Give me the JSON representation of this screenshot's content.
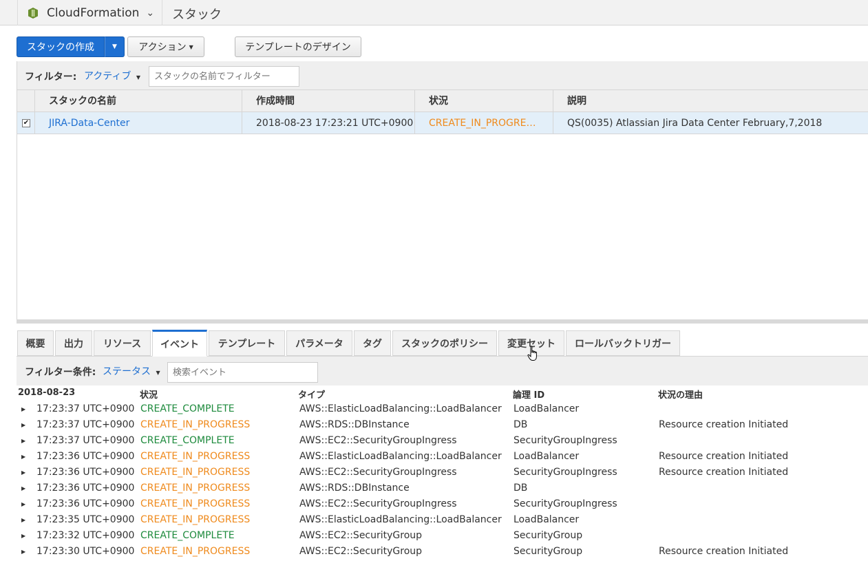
{
  "header": {
    "service_name": "CloudFormation",
    "breadcrumb": "スタック",
    "service_icon": "cloudformation-icon",
    "accent": "#1e6fd1"
  },
  "toolbar": {
    "create_label": "スタックの作成",
    "action_label": "アクション",
    "design_label": "テンプレートのデザイン"
  },
  "stack_filter": {
    "label": "フィルター:",
    "value": "アクティブ",
    "placeholder": "スタックの名前でフィルター"
  },
  "stack_table": {
    "columns": [
      "スタックの名前",
      "作成時間",
      "状況",
      "説明"
    ],
    "rows": [
      {
        "name": "JIRA-Data-Center",
        "created": "2018-08-23 17:23:21 UTC+0900",
        "status": "CREATE_IN_PROGRE…",
        "description": "QS(0035) Atlassian Jira Data Center February,7,2018"
      }
    ]
  },
  "tabs": [
    "概要",
    "出力",
    "リソース",
    "イベント",
    "テンプレート",
    "パラメータ",
    "タグ",
    "スタックのポリシー",
    "変更セット",
    "ロールバックトリガー"
  ],
  "active_tab": "イベント",
  "event_filter": {
    "label": "フィルター条件:",
    "value": "ステータス",
    "placeholder": "検索イベント"
  },
  "events": {
    "columns": [
      "2018-08-23",
      "状況",
      "タイプ",
      "論理 ID",
      "状況の理由"
    ],
    "rows": [
      {
        "time": "17:23:37 UTC+0900",
        "status": "CREATE_COMPLETE",
        "type": "AWS::ElasticLoadBalancing::LoadBalancer",
        "logical_id": "LoadBalancer",
        "reason": ""
      },
      {
        "time": "17:23:37 UTC+0900",
        "status": "CREATE_IN_PROGRESS",
        "type": "AWS::RDS::DBInstance",
        "logical_id": "DB",
        "reason": "Resource creation Initiated"
      },
      {
        "time": "17:23:37 UTC+0900",
        "status": "CREATE_COMPLETE",
        "type": "AWS::EC2::SecurityGroupIngress",
        "logical_id": "SecurityGroupIngress",
        "reason": ""
      },
      {
        "time": "17:23:36 UTC+0900",
        "status": "CREATE_IN_PROGRESS",
        "type": "AWS::ElasticLoadBalancing::LoadBalancer",
        "logical_id": "LoadBalancer",
        "reason": "Resource creation Initiated"
      },
      {
        "time": "17:23:36 UTC+0900",
        "status": "CREATE_IN_PROGRESS",
        "type": "AWS::EC2::SecurityGroupIngress",
        "logical_id": "SecurityGroupIngress",
        "reason": "Resource creation Initiated"
      },
      {
        "time": "17:23:36 UTC+0900",
        "status": "CREATE_IN_PROGRESS",
        "type": "AWS::RDS::DBInstance",
        "logical_id": "DB",
        "reason": ""
      },
      {
        "time": "17:23:36 UTC+0900",
        "status": "CREATE_IN_PROGRESS",
        "type": "AWS::EC2::SecurityGroupIngress",
        "logical_id": "SecurityGroupIngress",
        "reason": ""
      },
      {
        "time": "17:23:35 UTC+0900",
        "status": "CREATE_IN_PROGRESS",
        "type": "AWS::ElasticLoadBalancing::LoadBalancer",
        "logical_id": "LoadBalancer",
        "reason": ""
      },
      {
        "time": "17:23:32 UTC+0900",
        "status": "CREATE_COMPLETE",
        "type": "AWS::EC2::SecurityGroup",
        "logical_id": "SecurityGroup",
        "reason": ""
      },
      {
        "time": "17:23:30 UTC+0900",
        "status": "CREATE_IN_PROGRESS",
        "type": "AWS::EC2::SecurityGroup",
        "logical_id": "SecurityGroup",
        "reason": "Resource creation Initiated"
      }
    ]
  },
  "status_colors": {
    "CREATE_COMPLETE": "#1d8a3c",
    "CREATE_IN_PROGRESS": "#ef8a1c"
  }
}
